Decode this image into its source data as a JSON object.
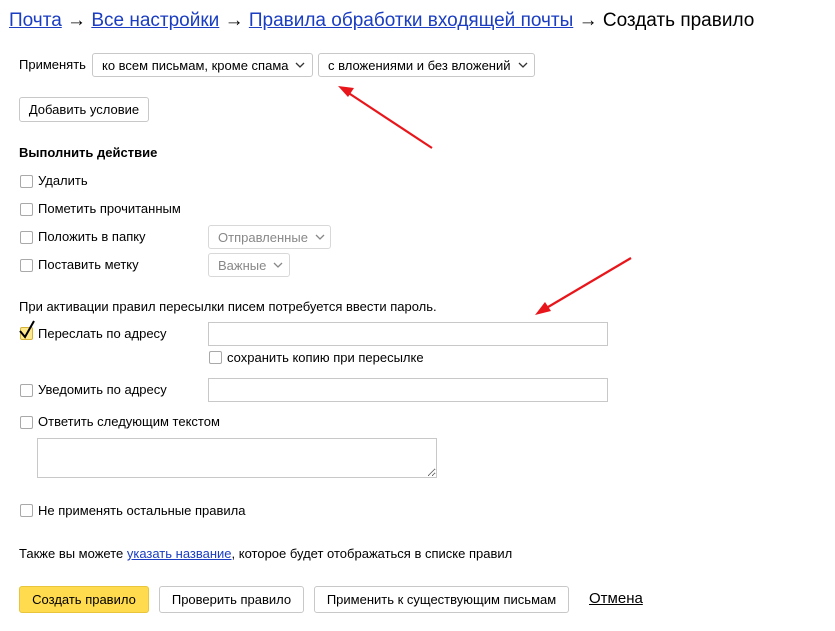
{
  "breadcrumb": {
    "items": [
      "Почта",
      "Все настройки",
      "Правила обработки входящей почты"
    ],
    "separator": "→",
    "current": "Создать правило"
  },
  "apply": {
    "label": "Применять",
    "scope_value": "ко всем письмам, кроме спама",
    "attachments_value": "с вложениями и без вложений"
  },
  "add_condition_label": "Добавить условие",
  "actions": {
    "heading": "Выполнить действие",
    "delete": {
      "label": "Удалить",
      "checked": false
    },
    "mark_read": {
      "label": "Пометить прочитанным",
      "checked": false
    },
    "move_to_folder": {
      "label": "Положить в папку",
      "checked": false,
      "folder_value": "Отправленные"
    },
    "set_label": {
      "label": "Поставить метку",
      "checked": false,
      "label_value": "Важные"
    }
  },
  "forward_notice": "При активации правил пересылки писем потребуется ввести пароль.",
  "forward": {
    "label": "Переслать по адресу",
    "checked": true,
    "address_value": "",
    "keep_copy_label": "сохранить копию при пересылке",
    "keep_copy_checked": false
  },
  "notify": {
    "label": "Уведомить по адресу",
    "checked": false,
    "address_value": ""
  },
  "reply": {
    "label": "Ответить следующим текстом",
    "checked": false,
    "text_value": ""
  },
  "stop_rules": {
    "label": "Не применять остальные правила",
    "checked": false
  },
  "name_hint": {
    "before": "Также вы можете ",
    "link": "указать название",
    "after": ", которое будет отображаться в списке правил"
  },
  "footer": {
    "create_label": "Создать правило",
    "check_label": "Проверить правило",
    "apply_existing_label": "Применить к существующим письмам",
    "cancel_label": "Отмена"
  },
  "colors": {
    "link": "#1a3dc1",
    "primary_button": "#ffdb4d",
    "annotation_arrow": "#e8161b"
  },
  "annotations": {
    "arrows": 2
  }
}
